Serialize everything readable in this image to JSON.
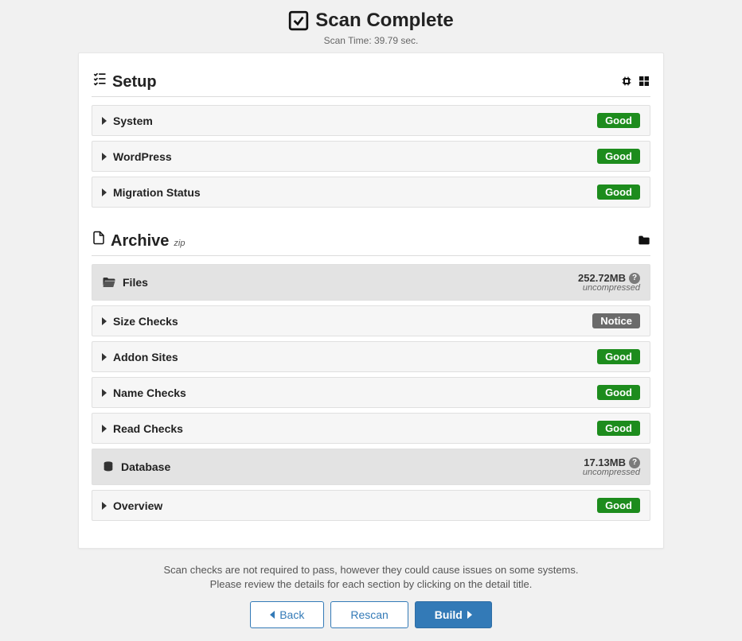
{
  "header": {
    "title": "Scan Complete",
    "scan_time": "Scan Time: 39.79 sec."
  },
  "sections": {
    "setup": {
      "title": "Setup",
      "items": [
        {
          "label": "System",
          "status": "Good",
          "status_class": "good"
        },
        {
          "label": "WordPress",
          "status": "Good",
          "status_class": "good"
        },
        {
          "label": "Migration Status",
          "status": "Good",
          "status_class": "good"
        }
      ]
    },
    "archive": {
      "title": "Archive",
      "suffix": "zip",
      "files": {
        "label": "Files",
        "size": "252.72MB",
        "note": "uncompressed",
        "items": [
          {
            "label": "Size Checks",
            "status": "Notice",
            "status_class": "notice"
          },
          {
            "label": "Addon Sites",
            "status": "Good",
            "status_class": "good"
          },
          {
            "label": "Name Checks",
            "status": "Good",
            "status_class": "good"
          },
          {
            "label": "Read Checks",
            "status": "Good",
            "status_class": "good"
          }
        ]
      },
      "database": {
        "label": "Database",
        "size": "17.13MB",
        "note": "uncompressed",
        "items": [
          {
            "label": "Overview",
            "status": "Good",
            "status_class": "good"
          }
        ]
      }
    }
  },
  "footer": {
    "line1": "Scan checks are not required to pass, however they could cause issues on some systems.",
    "line2": "Please review the details for each section by clicking on the detail title."
  },
  "buttons": {
    "back": "Back",
    "rescan": "Rescan",
    "build": "Build"
  }
}
